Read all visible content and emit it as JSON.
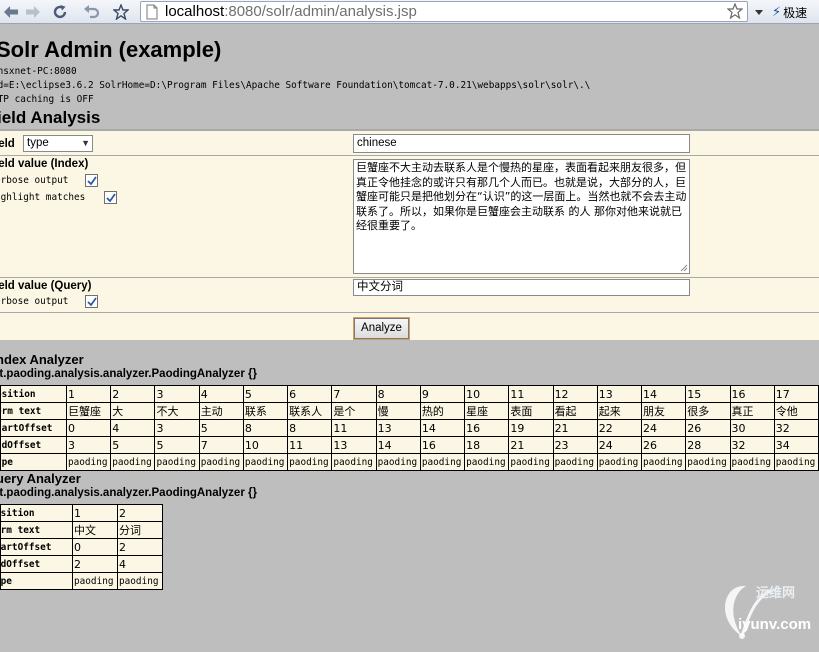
{
  "browser": {
    "url_host": "localhost",
    "url_rest": ":8080/solr/admin/analysis.jsp",
    "extension_label": "极速"
  },
  "header": {
    "title": "Solr Admin (example)",
    "host_line": "ansxnet-PC:8080",
    "cwd_line": "wd=E:\\eclipse3.6.2 SolrHome=D:\\Program Files\\Apache Software Foundation\\tomcat-7.0.21\\webapps\\solr\\solr\\.\\",
    "cache_line": "TTP caching is OFF"
  },
  "section_title": "ield Analysis",
  "form": {
    "field_label": "ield",
    "field_type_selected": "type",
    "field_name_value": "chinese",
    "index_label": "ield value (Index)",
    "index_verbose_label": "erbose output",
    "index_highlight_label": "ighlight matches",
    "index_text": "巨蟹座不大主动去联系人是个慢热的星座，表面看起来朋友很多，但真正令他挂念的或许只有那几个人而已。也就是说，大部分的人，巨蟹座可能只是把他划分在“认识”的这一层面上。当然也就不会去主动联系了。所以，如果你是巨蟹座会主动联系 的人 那你对他来说就已经很重要了。",
    "query_label": "ield value (Query)",
    "query_verbose_label": "erbose output",
    "query_text": "中文分词",
    "analyze_label": "Analyze",
    "index_verbose_checked": true,
    "index_highlight_checked": true,
    "query_verbose_checked": true
  },
  "index_analyzer": {
    "title": "ndex Analyzer",
    "class_name": "et.paoding.analysis.analyzer.PaodingAnalyzer {}",
    "row_labels": [
      "osition",
      "erm text",
      "tartOffset",
      "ndOffset",
      "ype"
    ],
    "columns": [
      {
        "position": "1",
        "term": "巨蟹座",
        "start": "0",
        "end": "3",
        "type": "paoding"
      },
      {
        "position": "2",
        "term": "大",
        "start": "4",
        "end": "5",
        "type": "paoding"
      },
      {
        "position": "3",
        "term": "不大",
        "start": "3",
        "end": "5",
        "type": "paoding"
      },
      {
        "position": "4",
        "term": "主动",
        "start": "5",
        "end": "7",
        "type": "paoding"
      },
      {
        "position": "5",
        "term": "联系",
        "start": "8",
        "end": "10",
        "type": "paoding"
      },
      {
        "position": "6",
        "term": "联系人",
        "start": "8",
        "end": "11",
        "type": "paoding"
      },
      {
        "position": "7",
        "term": "是个",
        "start": "11",
        "end": "13",
        "type": "paoding"
      },
      {
        "position": "8",
        "term": "慢",
        "start": "13",
        "end": "14",
        "type": "paoding"
      },
      {
        "position": "9",
        "term": "热的",
        "start": "14",
        "end": "16",
        "type": "paoding"
      },
      {
        "position": "10",
        "term": "星座",
        "start": "16",
        "end": "18",
        "type": "paoding"
      },
      {
        "position": "11",
        "term": "表面",
        "start": "19",
        "end": "21",
        "type": "paoding"
      },
      {
        "position": "12",
        "term": "看起",
        "start": "21",
        "end": "23",
        "type": "paoding"
      },
      {
        "position": "13",
        "term": "起来",
        "start": "22",
        "end": "24",
        "type": "paoding"
      },
      {
        "position": "14",
        "term": "朋友",
        "start": "24",
        "end": "26",
        "type": "paoding"
      },
      {
        "position": "15",
        "term": "很多",
        "start": "26",
        "end": "28",
        "type": "paoding"
      },
      {
        "position": "16",
        "term": "真正",
        "start": "30",
        "end": "32",
        "type": "paoding"
      },
      {
        "position": "17",
        "term": "令他",
        "start": "32",
        "end": "34",
        "type": "paoding"
      }
    ]
  },
  "query_analyzer": {
    "title": "uery Analyzer",
    "class_name": "et.paoding.analysis.analyzer.PaodingAnalyzer {}",
    "row_labels": [
      "osition",
      "erm text",
      "tartOffset",
      "ndOffset",
      "ype"
    ],
    "columns": [
      {
        "position": "1",
        "term": "中文",
        "start": "0",
        "end": "2",
        "type": "paoding"
      },
      {
        "position": "2",
        "term": "分词",
        "start": "2",
        "end": "4",
        "type": "paoding"
      }
    ]
  },
  "watermark": {
    "cn": "运维网",
    "url": "iyunv.com"
  },
  "colors": {
    "page_bg": "#bebebe",
    "form_bg": "#fbf7e4",
    "table_bg": "#fbf7e4",
    "check_color": "#2a5aa8"
  }
}
